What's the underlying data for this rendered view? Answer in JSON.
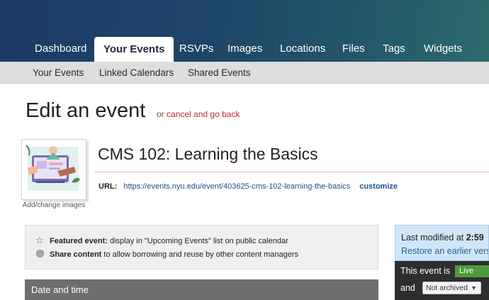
{
  "nav": {
    "tabs": [
      {
        "label": "Dashboard"
      },
      {
        "label": "Your Events"
      },
      {
        "label": "RSVPs"
      },
      {
        "label": "Images"
      },
      {
        "label": "Locations"
      },
      {
        "label": "Files"
      },
      {
        "label": "Tags"
      },
      {
        "label": "Widgets"
      }
    ],
    "active_tab": "Your Events"
  },
  "subnav": {
    "items": [
      {
        "label": "Your Events"
      },
      {
        "label": "Linked Calendars"
      },
      {
        "label": "Shared Events"
      }
    ]
  },
  "header": {
    "title": "Edit an event",
    "or_text": "or",
    "cancel_link": "cancel and go back"
  },
  "image": {
    "caption": "Add/change images",
    "icon": "event-thumbnail-illustration"
  },
  "event": {
    "title": "CMS 102: Learning the Basics",
    "url_label": "URL:",
    "url": "https://events.nyu.edu/event/403625-cms-102-learning-the-basics",
    "customize_label": "customize"
  },
  "options": {
    "featured_label": "Featured event:",
    "featured_desc": "display in \"Upcoming Events\" list on public calendar",
    "share_label": "Share content",
    "share_desc": "to allow borrowing and reuse by other content managers"
  },
  "sections": {
    "date_time": "Date and time"
  },
  "status": {
    "last_modified_prefix": "Last modified at",
    "last_modified_time": "2:59",
    "restore_link": "Restore an earlier vers",
    "this_event_is": "This event is",
    "live_badge": "Live",
    "and_text": "and",
    "archive_value": "Not archived"
  },
  "colors": {
    "accent_link": "#c0282d",
    "link_blue": "#1f4f86",
    "live_green": "#4e9a3c"
  }
}
